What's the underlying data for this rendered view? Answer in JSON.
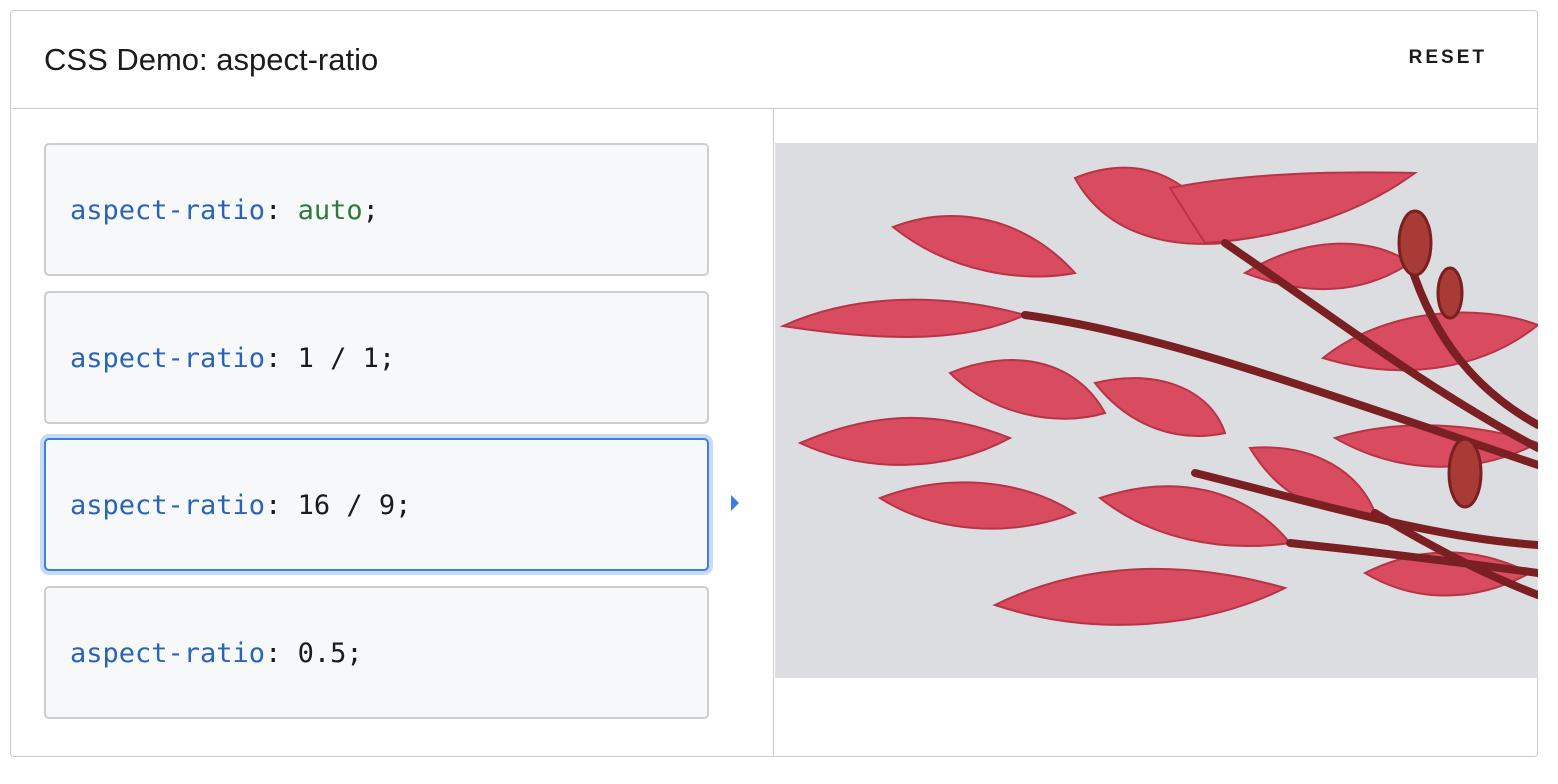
{
  "header": {
    "title": "CSS Demo: aspect-ratio",
    "reset_label": "RESET"
  },
  "options": [
    {
      "property": "aspect-ratio",
      "colon": ": ",
      "value": "auto",
      "semicolon": ";"
    },
    {
      "property": "aspect-ratio",
      "colon": ": ",
      "value": "1 / 1",
      "semicolon": ";"
    },
    {
      "property": "aspect-ratio",
      "colon": ": ",
      "value": "16 / 9",
      "semicolon": ";"
    },
    {
      "property": "aspect-ratio",
      "colon": ": ",
      "value": "0.5",
      "semicolon": ";"
    }
  ],
  "selected_option": "16 / 9",
  "preview": {
    "image_subject": "red-frangipani-flowers-icon"
  },
  "colors": {
    "property": "#2a63b8",
    "keyword": "#2f7a3a",
    "selected_border": "#3d7de4",
    "image_background": "#dcdde0",
    "petal": "#d94b5e"
  }
}
